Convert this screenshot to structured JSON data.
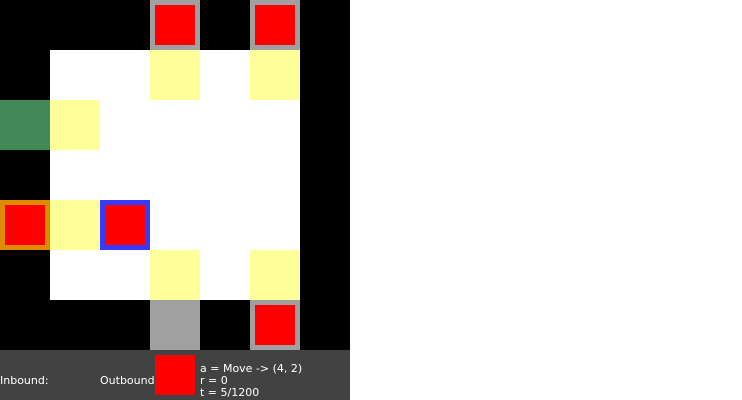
{
  "board": {
    "cols": 7,
    "rows": 7,
    "legend": {
      "B": "wall",
      "W": "floor",
      "Y": "highlighted-floor",
      "G": "goal-zone",
      "X": "gray-slot"
    },
    "tiles": [
      [
        "B",
        "B",
        "B",
        "X",
        "B",
        "X",
        "B"
      ],
      [
        "B",
        "W",
        "W",
        "Y",
        "W",
        "Y",
        "B"
      ],
      [
        "G",
        "Y",
        "W",
        "W",
        "W",
        "W",
        "B"
      ],
      [
        "B",
        "W",
        "W",
        "W",
        "W",
        "W",
        "B"
      ],
      [
        "X",
        "Y",
        "X",
        "W",
        "W",
        "W",
        "B"
      ],
      [
        "B",
        "W",
        "W",
        "Y",
        "W",
        "Y",
        "B"
      ],
      [
        "B",
        "B",
        "B",
        "X",
        "B",
        "X",
        "B"
      ]
    ],
    "colors": {
      "wall": "#000000",
      "floor": "#ffffff",
      "highlighted_floor": "#ffff99",
      "goal_zone": "#418a57",
      "gray_slot": "#a0a0a0",
      "item": "#ff0000",
      "agent_border": "#3a3aff",
      "inbound_border": "#e08a00",
      "status_bar": "#424242"
    },
    "items": [
      {
        "row": 0,
        "col": 3,
        "frame": "gray"
      },
      {
        "row": 0,
        "col": 5,
        "frame": "gray"
      },
      {
        "row": 4,
        "col": 0,
        "frame": "orange"
      },
      {
        "row": 4,
        "col": 2,
        "frame": "agent"
      },
      {
        "row": 6,
        "col": 5,
        "frame": "gray"
      }
    ]
  },
  "status": {
    "inbound_label": "Inbound:",
    "outbound_label": "Outbound:",
    "outbound_item_color": "#ff0000",
    "action_line": "a = Move -> (4, 2)",
    "reward_line": "r = 0",
    "time_line": "t = 5/1200"
  }
}
